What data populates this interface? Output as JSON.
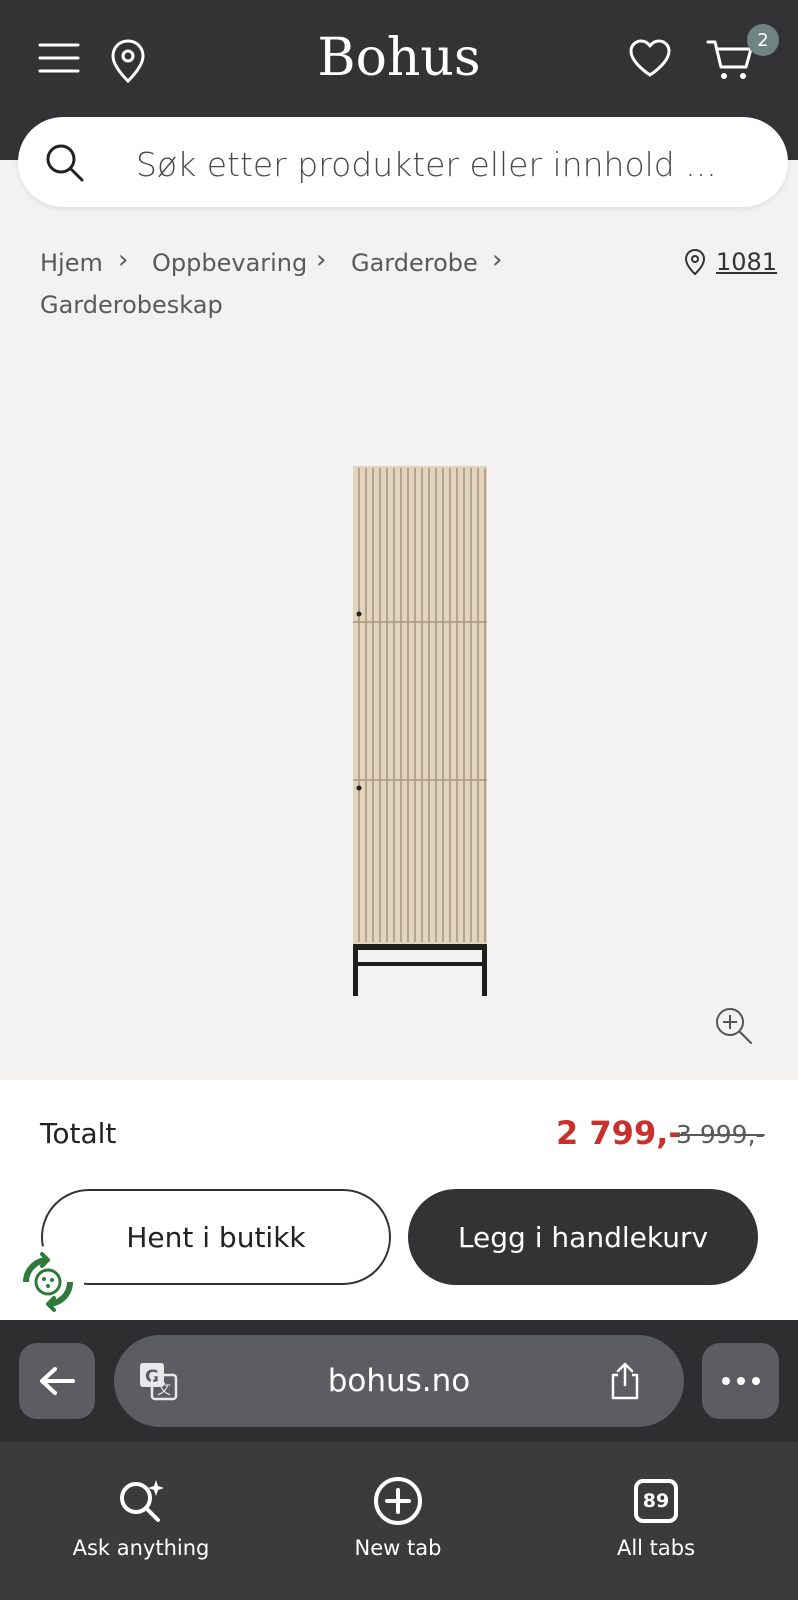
{
  "header": {
    "logo": "Bohus",
    "cart_count": "2"
  },
  "search": {
    "placeholder": "Søk etter produkter eller innhold ..."
  },
  "breadcrumb": {
    "items": [
      "Hjem",
      "Oppbevaring",
      "Garderobe",
      "Garderobeskap"
    ],
    "store_code": "1081"
  },
  "summary": {
    "total_label": "Totalt",
    "price": "2 799,-",
    "old_price": "3 999,-"
  },
  "actions": {
    "pickup_label": "Hent i butikk",
    "add_to_cart_label": "Legg i handlekurv"
  },
  "browser": {
    "url": "bohus.no",
    "tabs_count": "89",
    "toolbar": {
      "ask_label": "Ask anything",
      "new_tab_label": "New tab",
      "all_tabs_label": "All tabs"
    }
  },
  "colors": {
    "header_bg": "#333336",
    "price_red": "#c9302c",
    "badge": "#6f8583"
  }
}
